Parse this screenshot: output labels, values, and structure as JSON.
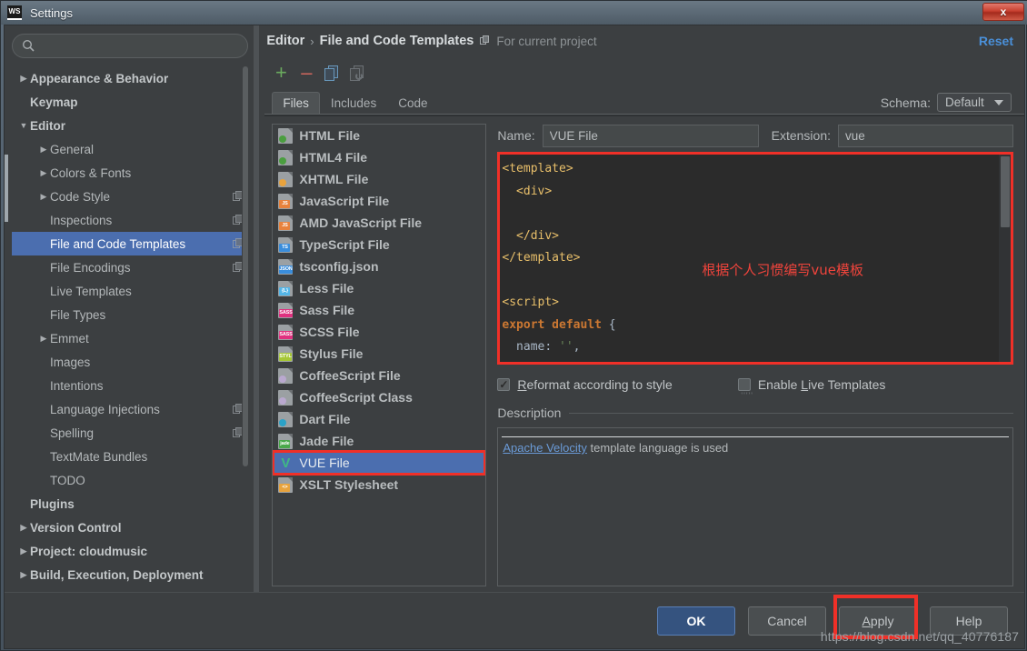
{
  "window": {
    "app_badge": "WS",
    "title": "Settings",
    "close_label": "x"
  },
  "search": {
    "value": "",
    "placeholder": ""
  },
  "sidebar": {
    "items": [
      {
        "label": "Appearance & Behavior",
        "twisty": "right",
        "indent": 0,
        "bold": true,
        "copy": false,
        "selected": false
      },
      {
        "label": "Keymap",
        "twisty": "none",
        "indent": 0,
        "bold": true,
        "copy": false,
        "selected": false
      },
      {
        "label": "Editor",
        "twisty": "down",
        "indent": 0,
        "bold": true,
        "copy": false,
        "selected": false
      },
      {
        "label": "General",
        "twisty": "right",
        "indent": 1,
        "bold": false,
        "copy": false,
        "selected": false
      },
      {
        "label": "Colors & Fonts",
        "twisty": "right",
        "indent": 1,
        "bold": false,
        "copy": false,
        "selected": false
      },
      {
        "label": "Code Style",
        "twisty": "right",
        "indent": 1,
        "bold": false,
        "copy": true,
        "selected": false
      },
      {
        "label": "Inspections",
        "twisty": "none",
        "indent": 1,
        "bold": false,
        "copy": true,
        "selected": false
      },
      {
        "label": "File and Code Templates",
        "twisty": "none",
        "indent": 1,
        "bold": false,
        "copy": true,
        "selected": true
      },
      {
        "label": "File Encodings",
        "twisty": "none",
        "indent": 1,
        "bold": false,
        "copy": true,
        "selected": false
      },
      {
        "label": "Live Templates",
        "twisty": "none",
        "indent": 1,
        "bold": false,
        "copy": false,
        "selected": false
      },
      {
        "label": "File Types",
        "twisty": "none",
        "indent": 1,
        "bold": false,
        "copy": false,
        "selected": false
      },
      {
        "label": "Emmet",
        "twisty": "right",
        "indent": 1,
        "bold": false,
        "copy": false,
        "selected": false
      },
      {
        "label": "Images",
        "twisty": "none",
        "indent": 1,
        "bold": false,
        "copy": false,
        "selected": false
      },
      {
        "label": "Intentions",
        "twisty": "none",
        "indent": 1,
        "bold": false,
        "copy": false,
        "selected": false
      },
      {
        "label": "Language Injections",
        "twisty": "none",
        "indent": 1,
        "bold": false,
        "copy": true,
        "selected": false
      },
      {
        "label": "Spelling",
        "twisty": "none",
        "indent": 1,
        "bold": false,
        "copy": true,
        "selected": false
      },
      {
        "label": "TextMate Bundles",
        "twisty": "none",
        "indent": 1,
        "bold": false,
        "copy": false,
        "selected": false
      },
      {
        "label": "TODO",
        "twisty": "none",
        "indent": 1,
        "bold": false,
        "copy": false,
        "selected": false
      },
      {
        "label": "Plugins",
        "twisty": "none",
        "indent": 0,
        "bold": true,
        "copy": false,
        "selected": false
      },
      {
        "label": "Version Control",
        "twisty": "right",
        "indent": 0,
        "bold": true,
        "copy": false,
        "selected": false
      },
      {
        "label": "Project: cloudmusic",
        "twisty": "right",
        "indent": 0,
        "bold": true,
        "copy": false,
        "selected": false
      },
      {
        "label": "Build, Execution, Deployment",
        "twisty": "right",
        "indent": 0,
        "bold": true,
        "copy": false,
        "selected": false
      }
    ]
  },
  "header": {
    "breadcrumb_root": "Editor",
    "breadcrumb_sep": "›",
    "breadcrumb_leaf": "File and Code Templates",
    "scope_note": "For current project",
    "reset_label": "Reset",
    "schema_label": "Schema:",
    "schema_value": "Default"
  },
  "toolbar": {
    "add_label": "+",
    "remove_label": "–"
  },
  "tabs": [
    {
      "label": "Files",
      "active": true
    },
    {
      "label": "Includes",
      "active": false
    },
    {
      "label": "Code",
      "active": false
    }
  ],
  "file_list": {
    "items": [
      {
        "label": "HTML File",
        "icon": "html-file-icon",
        "badge": "",
        "badge_color": "#4a9e3f",
        "selected": false
      },
      {
        "label": "HTML4 File",
        "icon": "html4-file-icon",
        "badge": "",
        "badge_color": "#4a9e3f",
        "selected": false
      },
      {
        "label": "XHTML File",
        "icon": "xhtml-file-icon",
        "badge": "",
        "badge_color": "#e8a33d",
        "selected": false
      },
      {
        "label": "JavaScript File",
        "icon": "javascript-file-icon",
        "badge": "JS",
        "badge_color": "#e8823c",
        "selected": false
      },
      {
        "label": "AMD JavaScript File",
        "icon": "amd-javascript-file-icon",
        "badge": "JS",
        "badge_color": "#e8823c",
        "selected": false
      },
      {
        "label": "TypeScript File",
        "icon": "typescript-file-icon",
        "badge": "TS",
        "badge_color": "#3a8ddb",
        "selected": false
      },
      {
        "label": "tsconfig.json",
        "icon": "json-file-icon",
        "badge": "JSON",
        "badge_color": "#3a8ddb",
        "selected": false
      },
      {
        "label": "Less File",
        "icon": "less-file-icon",
        "badge": "{L}",
        "badge_color": "#54b6e8",
        "selected": false
      },
      {
        "label": "Sass File",
        "icon": "sass-file-icon",
        "badge": "SASS",
        "badge_color": "#e0317f",
        "selected": false
      },
      {
        "label": "SCSS File",
        "icon": "scss-file-icon",
        "badge": "SASS",
        "badge_color": "#e0317f",
        "selected": false
      },
      {
        "label": "Stylus File",
        "icon": "stylus-file-icon",
        "badge": "STYL",
        "badge_color": "#a6c736",
        "selected": false
      },
      {
        "label": "CoffeeScript File",
        "icon": "coffeescript-file-icon",
        "badge": "",
        "badge_color": "#b9a8cf",
        "selected": false
      },
      {
        "label": "CoffeeScript Class",
        "icon": "coffeescript-class-icon",
        "badge": "",
        "badge_color": "#b9a8cf",
        "selected": false
      },
      {
        "label": "Dart File",
        "icon": "dart-file-icon",
        "badge": "",
        "badge_color": "#2aa2c8",
        "selected": false
      },
      {
        "label": "Jade File",
        "icon": "jade-file-icon",
        "badge": "jade",
        "badge_color": "#4aa84a",
        "selected": false
      },
      {
        "label": "VUE File",
        "icon": "vue-file-icon",
        "badge": "",
        "badge_color": "#3fb984",
        "selected": true
      },
      {
        "label": "XSLT Stylesheet",
        "icon": "xslt-file-icon",
        "badge": "<>",
        "badge_color": "#e8a33d",
        "selected": false
      }
    ]
  },
  "editor_form": {
    "name_label": "Name:",
    "name_value": "VUE File",
    "extension_label": "Extension:",
    "extension_value": "vue",
    "code_lines": [
      {
        "segments": [
          {
            "t": "<template>",
            "c": "c-tag"
          }
        ]
      },
      {
        "segments": [
          {
            "t": "  <div>",
            "c": "c-tag"
          }
        ]
      },
      {
        "segments": [
          {
            "t": "",
            "c": "c-tag"
          }
        ]
      },
      {
        "segments": [
          {
            "t": "  </div>",
            "c": "c-tag"
          }
        ]
      },
      {
        "segments": [
          {
            "t": "</template>",
            "c": "c-tag"
          }
        ]
      },
      {
        "segments": [
          {
            "t": "",
            "c": "c-tag"
          }
        ]
      },
      {
        "segments": [
          {
            "t": "<script>",
            "c": "c-tag"
          }
        ]
      },
      {
        "segments": [
          {
            "t": "export default",
            "c": "c-kw"
          },
          {
            "t": " {",
            "c": "c-prop"
          }
        ]
      },
      {
        "segments": [
          {
            "t": "  name: ",
            "c": "c-prop"
          },
          {
            "t": "''",
            "c": "c-str"
          },
          {
            "t": ",",
            "c": "c-prop"
          }
        ]
      }
    ],
    "annotation": "根据个人习惯编写vue模板",
    "reformat_checkbox": {
      "label_pre": "R",
      "label_post": "eformat according to style",
      "checked": true
    },
    "live_templates_checkbox": {
      "label_pre": "Enable ",
      "label_mid": "L",
      "label_post": "ive Templates",
      "checked": false
    },
    "description_title": "Description",
    "description_link": "Apache Velocity",
    "description_rest": " template language is used"
  },
  "footer": {
    "ok_label": "OK",
    "cancel_label": "Cancel",
    "apply_label_pre": "A",
    "apply_label_post": "pply",
    "help_label": "Help",
    "watermark": "https://blog.csdn.net/qq_40776187"
  },
  "colors": {
    "selection_blue": "#4b6eaf",
    "accent_link": "#4a90d9",
    "highlight_red": "#f03028",
    "panel_bg": "#3c3f41",
    "editor_bg": "#2b2b2b"
  }
}
